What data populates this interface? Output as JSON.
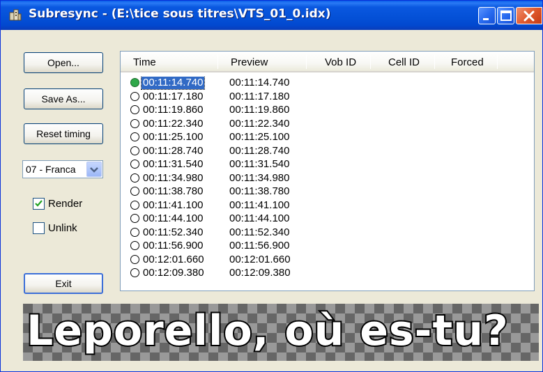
{
  "window": {
    "title": "Subresync - (E:\\tice sous titres\\VTS_01_0.idx)"
  },
  "buttons": {
    "open": "Open...",
    "save_as": "Save As...",
    "reset_timing": "Reset timing",
    "exit": "Exit"
  },
  "language_select": {
    "value": "07 - Franca"
  },
  "checkboxes": {
    "render": {
      "label": "Render",
      "checked": true
    },
    "unlink": {
      "label": "Unlink",
      "checked": false
    }
  },
  "list": {
    "columns": [
      "Time",
      "Preview",
      "Vob ID",
      "Cell ID",
      "Forced"
    ],
    "rows": [
      {
        "time": "00:11:14.740",
        "preview": "00:11:14.740",
        "selected": true
      },
      {
        "time": "00:11:17.180",
        "preview": "00:11:17.180"
      },
      {
        "time": "00:11:19.860",
        "preview": "00:11:19.860"
      },
      {
        "time": "00:11:22.340",
        "preview": "00:11:22.340"
      },
      {
        "time": "00:11:25.100",
        "preview": "00:11:25.100"
      },
      {
        "time": "00:11:28.740",
        "preview": "00:11:28.740"
      },
      {
        "time": "00:11:31.540",
        "preview": "00:11:31.540"
      },
      {
        "time": "00:11:34.980",
        "preview": "00:11:34.980"
      },
      {
        "time": "00:11:38.780",
        "preview": "00:11:38.780"
      },
      {
        "time": "00:11:41.100",
        "preview": "00:11:41.100"
      },
      {
        "time": "00:11:44.100",
        "preview": "00:11:44.100"
      },
      {
        "time": "00:11:52.340",
        "preview": "00:11:52.340"
      },
      {
        "time": "00:11:56.900",
        "preview": "00:11:56.900"
      },
      {
        "time": "00:12:01.660",
        "preview": "00:12:01.660"
      },
      {
        "time": "00:12:09.380",
        "preview": "00:12:09.380"
      }
    ]
  },
  "subtitle_preview": {
    "text": "Leporello, où es-tu?"
  },
  "colors": {
    "titlebar": "#0450d6",
    "selection": "#316ac5",
    "active_marker": "#2fa84a",
    "close_button": "#e05a2f"
  },
  "icons": {
    "app": "subresync-app-icon",
    "minimize": "minimize-icon",
    "maximize": "maximize-icon",
    "close": "close-icon",
    "dropdown": "chevron-down-icon"
  }
}
